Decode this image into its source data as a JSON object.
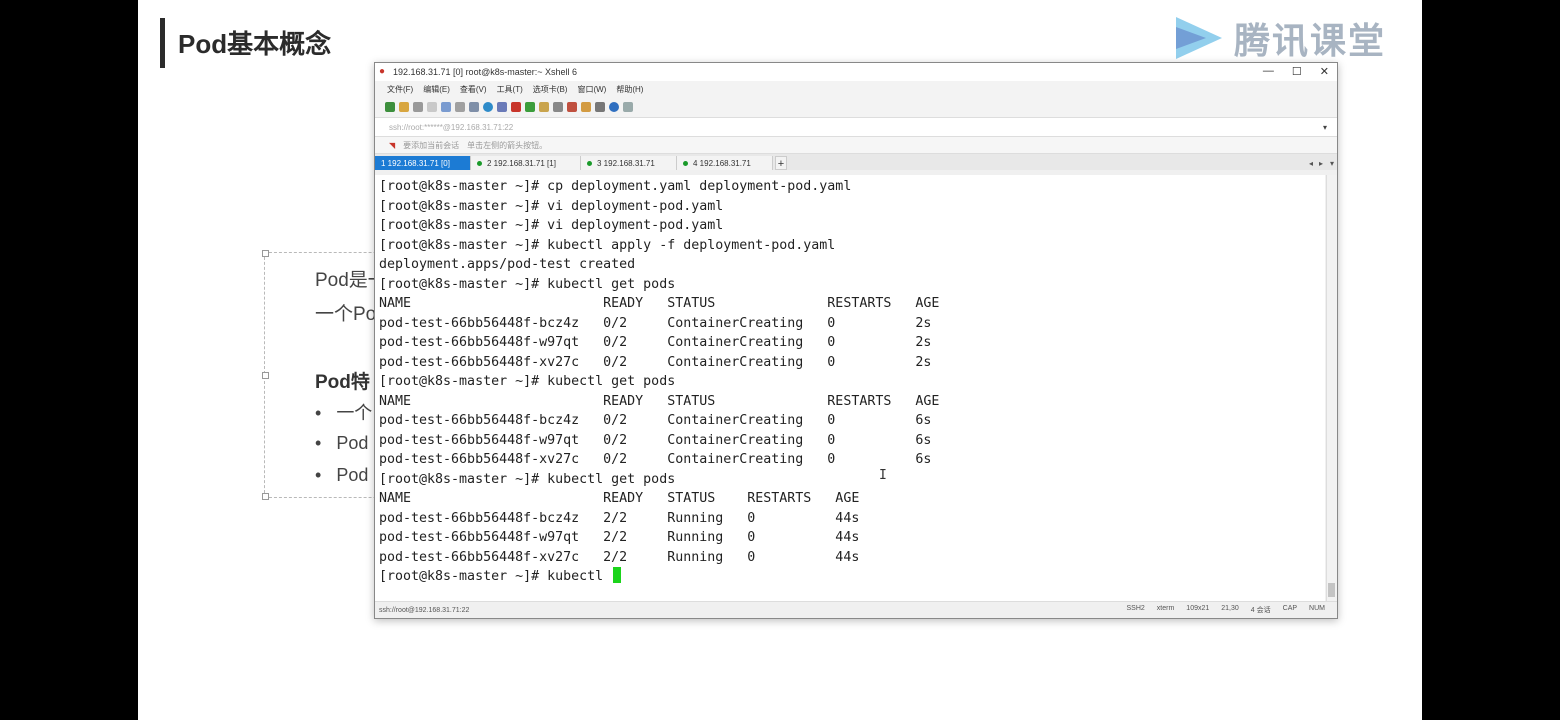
{
  "slide": {
    "title": "Pod基本概念",
    "logo_text": "腾讯课堂",
    "textbox": {
      "line1": "Pod是一",
      "line2": "一个Po",
      "heading": "Pod特",
      "bullets": [
        "一个",
        "Pod",
        "Pod"
      ]
    }
  },
  "xshell": {
    "title": "192.168.31.71 [0]    root@k8s-master:~    Xshell 6",
    "menu": [
      "文件(F)",
      "编辑(E)",
      "查看(V)",
      "工具(T)",
      "选项卡(B)",
      "窗口(W)",
      "帮助(H)"
    ],
    "address": "ssh://root:******@192.168.31.71:22",
    "links": [
      "要添加当前会话",
      "单击左侧的箭头按钮。"
    ],
    "tabs": [
      {
        "label": "1 192.168.31.71 [0]"
      },
      {
        "label": "2 192.168.31.71 [1]"
      },
      {
        "label": "3 192.168.31.71"
      },
      {
        "label": "4 192.168.31.71"
      }
    ],
    "terminal_lines": [
      "[root@k8s-master ~]# cp deployment.yaml deployment-pod.yaml",
      "[root@k8s-master ~]# vi deployment-pod.yaml",
      "[root@k8s-master ~]# vi deployment-pod.yaml",
      "[root@k8s-master ~]# kubectl apply -f deployment-pod.yaml",
      "deployment.apps/pod-test created",
      "[root@k8s-master ~]# kubectl get pods",
      "NAME                        READY   STATUS              RESTARTS   AGE",
      "pod-test-66bb56448f-bcz4z   0/2     ContainerCreating   0          2s",
      "pod-test-66bb56448f-w97qt   0/2     ContainerCreating   0          2s",
      "pod-test-66bb56448f-xv27c   0/2     ContainerCreating   0          2s",
      "[root@k8s-master ~]# kubectl get pods",
      "NAME                        READY   STATUS              RESTARTS   AGE",
      "pod-test-66bb56448f-bcz4z   0/2     ContainerCreating   0          6s",
      "pod-test-66bb56448f-w97qt   0/2     ContainerCreating   0          6s",
      "pod-test-66bb56448f-xv27c   0/2     ContainerCreating   0          6s",
      "[root@k8s-master ~]# kubectl get pods",
      "NAME                        READY   STATUS    RESTARTS   AGE",
      "pod-test-66bb56448f-bcz4z   2/2     Running   0          44s",
      "pod-test-66bb56448f-w97qt   2/2     Running   0          44s",
      "pod-test-66bb56448f-xv27c   2/2     Running   0          44s"
    ],
    "prompt_line": "[root@k8s-master ~]# kubectl ",
    "status": {
      "left": "ssh://root@192.168.31.71:22",
      "items": [
        "SSH2",
        "xterm",
        "109x21",
        "21,30",
        "4 会话",
        "CAP",
        "NUM"
      ]
    }
  }
}
